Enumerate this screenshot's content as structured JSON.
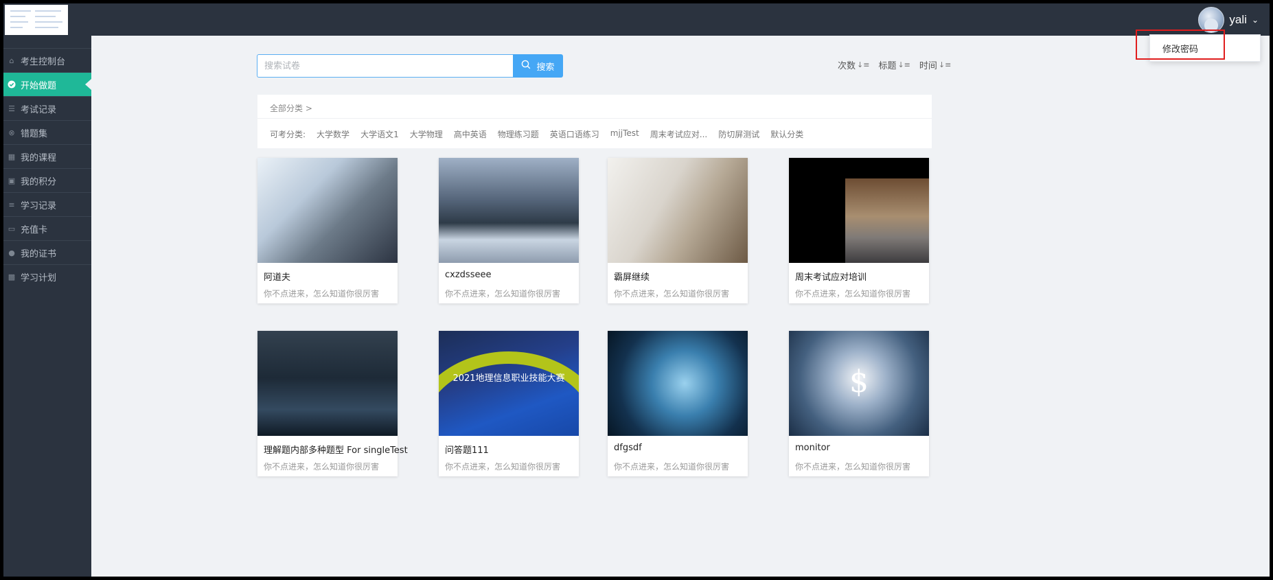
{
  "header": {
    "username": "yali",
    "dropdown_item": "修改密码"
  },
  "sidebar": {
    "items": [
      {
        "label": "考生控制台",
        "icon": "home-icon"
      },
      {
        "label": "开始做题",
        "icon": "check-circle-icon",
        "active": true
      },
      {
        "label": "考试记录",
        "icon": "list-icon"
      },
      {
        "label": "错题集",
        "icon": "close-circle-icon"
      },
      {
        "label": "我的课程",
        "icon": "book-icon"
      },
      {
        "label": "我的积分",
        "icon": "gift-icon"
      },
      {
        "label": "学习记录",
        "icon": "align-left-icon"
      },
      {
        "label": "充值卡",
        "icon": "credit-card-icon"
      },
      {
        "label": "我的证书",
        "icon": "dot-icon"
      },
      {
        "label": "学习计划",
        "icon": "calendar-icon"
      }
    ]
  },
  "search": {
    "placeholder": "搜索试卷",
    "button_label": "搜索"
  },
  "sort": {
    "count": "次数",
    "title": "标题",
    "time": "时间"
  },
  "categories": {
    "breadcrumb": "全部分类 >",
    "label": "可考分类:",
    "tags": [
      "大学数学",
      "大学语文1",
      "大学物理",
      "高中英语",
      "物理练习题",
      "英语口语练习",
      "mjjTest",
      "周末考试应对...",
      "防切屏测试",
      "默认分类"
    ]
  },
  "cards": [
    {
      "title": "阿道夫",
      "desc": "你不点进来，怎么知道你很厉害",
      "image": "finance-coins-image"
    },
    {
      "title": "cxzdsseee",
      "desc": "你不点进来，怎么知道你很厉害",
      "image": "snowy-forest-image"
    },
    {
      "title": "霸屏继续",
      "desc": "你不点进来，怎么知道你很厉害",
      "image": "laptop-meeting-image"
    },
    {
      "title": "周末考试应对培训",
      "desc": "你不点进来，怎么知道你很厉害",
      "image": "smiling-man-portrait-image"
    },
    {
      "title": "理解题内部多种题型 For singleTest",
      "desc": "你不点进来，怎么知道你很厉害",
      "image": "businessman-phone-image"
    },
    {
      "title": "问答题111",
      "desc": "你不点进来，怎么知道你很厉害",
      "image": "contest-banner-image",
      "banner_text": "2021地理信息职业技能大赛"
    },
    {
      "title": "dfgsdf",
      "desc": "你不点进来，怎么知道你很厉害",
      "image": "tech-globe-image"
    },
    {
      "title": "monitor",
      "desc": "你不点进来，怎么知道你很厉害",
      "image": "dollar-globe-image",
      "glyph": "$"
    }
  ],
  "colors": {
    "sidebar_bg": "#2b333f",
    "active_item": "#1fb898",
    "search_button": "#45a7f5",
    "highlight_box": "#e01d1d"
  }
}
